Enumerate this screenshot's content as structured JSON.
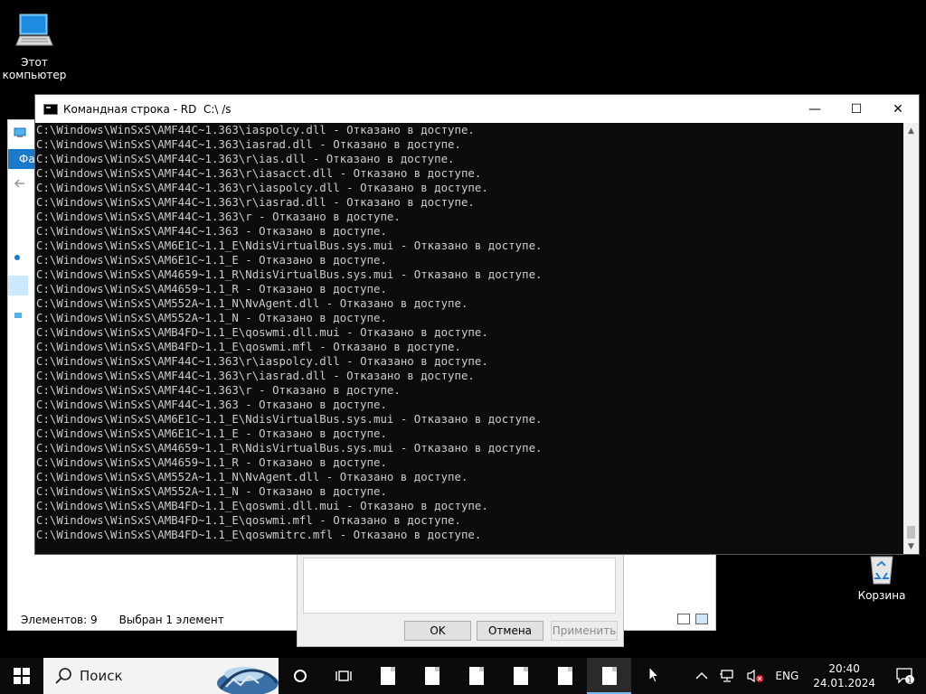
{
  "desktop": {
    "this_pc_label_1": "Этот",
    "this_pc_label_2": "компьютер",
    "recycle_bin_label": "Корзина"
  },
  "explorer": {
    "ribbon_tab_file": "Фай",
    "status_items": "Элементов: 9",
    "status_selected": "Выбран 1 элемент"
  },
  "properties_dialog": {
    "ok_label": "OK",
    "cancel_label": "Отмена",
    "apply_label": "Применить"
  },
  "cmd": {
    "title": "Командная строка - RD  C:\\ /s",
    "minimize": "—",
    "maximize": "☐",
    "close": "✕",
    "lines": [
      "C:\\Windows\\WinSxS\\AMF44C~1.363\\iaspolcy.dll - Отказано в доступе.",
      "C:\\Windows\\WinSxS\\AMF44C~1.363\\iasrad.dll - Отказано в доступе.",
      "C:\\Windows\\WinSxS\\AMF44C~1.363\\r\\ias.dll - Отказано в доступе.",
      "C:\\Windows\\WinSxS\\AMF44C~1.363\\r\\iasacct.dll - Отказано в доступе.",
      "C:\\Windows\\WinSxS\\AMF44C~1.363\\r\\iaspolcy.dll - Отказано в доступе.",
      "C:\\Windows\\WinSxS\\AMF44C~1.363\\r\\iasrad.dll - Отказано в доступе.",
      "C:\\Windows\\WinSxS\\AMF44C~1.363\\r - Отказано в доступе.",
      "C:\\Windows\\WinSxS\\AMF44C~1.363 - Отказано в доступе.",
      "C:\\Windows\\WinSxS\\AM6E1C~1.1_E\\NdisVirtualBus.sys.mui - Отказано в доступе.",
      "C:\\Windows\\WinSxS\\AM6E1C~1.1_E - Отказано в доступе.",
      "C:\\Windows\\WinSxS\\AM4659~1.1_R\\NdisVirtualBus.sys.mui - Отказано в доступе.",
      "C:\\Windows\\WinSxS\\AM4659~1.1_R - Отказано в доступе.",
      "C:\\Windows\\WinSxS\\AM552A~1.1_N\\NvAgent.dll - Отказано в доступе.",
      "C:\\Windows\\WinSxS\\AM552A~1.1_N - Отказано в доступе.",
      "C:\\Windows\\WinSxS\\AMB4FD~1.1_E\\qoswmi.dll.mui - Отказано в доступе.",
      "C:\\Windows\\WinSxS\\AMB4FD~1.1_E\\qoswmi.mfl - Отказано в доступе.",
      "C:\\Windows\\WinSxS\\AMF44C~1.363\\r\\iaspolcy.dll - Отказано в доступе.",
      "C:\\Windows\\WinSxS\\AMF44C~1.363\\r\\iasrad.dll - Отказано в доступе.",
      "C:\\Windows\\WinSxS\\AMF44C~1.363\\r - Отказано в доступе.",
      "C:\\Windows\\WinSxS\\AMF44C~1.363 - Отказано в доступе.",
      "C:\\Windows\\WinSxS\\AM6E1C~1.1_E\\NdisVirtualBus.sys.mui - Отказано в доступе.",
      "C:\\Windows\\WinSxS\\AM6E1C~1.1_E - Отказано в доступе.",
      "C:\\Windows\\WinSxS\\AM4659~1.1_R\\NdisVirtualBus.sys.mui - Отказано в доступе.",
      "C:\\Windows\\WinSxS\\AM4659~1.1_R - Отказано в доступе.",
      "C:\\Windows\\WinSxS\\AM552A~1.1_N\\NvAgent.dll - Отказано в доступе.",
      "C:\\Windows\\WinSxS\\AM552A~1.1_N - Отказано в доступе.",
      "C:\\Windows\\WinSxS\\AMB4FD~1.1_E\\qoswmi.dll.mui - Отказано в доступе.",
      "C:\\Windows\\WinSxS\\AMB4FD~1.1_E\\qoswmi.mfl - Отказано в доступе.",
      "C:\\Windows\\WinSxS\\AMB4FD~1.1_E\\qoswmitrc.mfl - Отказано в доступе."
    ]
  },
  "taskbar": {
    "search_placeholder": "Поиск",
    "language": "ENG",
    "time": "20:40",
    "date": "24.01.2024",
    "notification_count": "1",
    "open_files": 6
  },
  "colors": {
    "console_bg": "#0c0c0c",
    "console_text": "#cccccc",
    "accent": "#1979ca"
  }
}
